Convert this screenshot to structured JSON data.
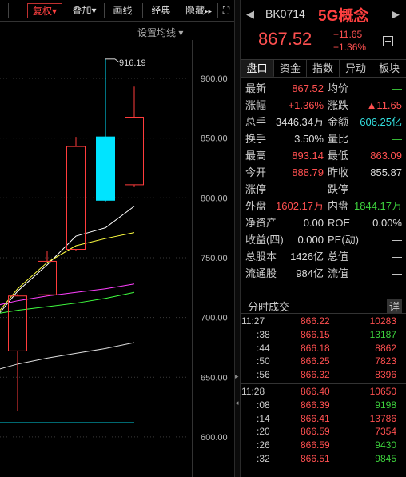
{
  "toolbar": {
    "items": [
      "一",
      "复权",
      "叠加",
      "画线",
      "经典",
      "隐藏"
    ],
    "fuquan_arrow": "▾",
    "diejia_arrow": "▾",
    "more_icon": "▸▸",
    "expand_icon": "⛶"
  },
  "chart": {
    "settings_label": "设置均线",
    "settings_arrow": "▾",
    "high_marker": "916.19",
    "price_axis": [
      "900.00",
      "850.00",
      "800.00",
      "750.00",
      "700.00",
      "650.00",
      "600.00"
    ],
    "colors": {
      "up": "#ff3c3c",
      "down": "#00e4ff",
      "ma1": "#ffffff",
      "ma2": "#ffff40",
      "ma3": "#ff40ff",
      "ma4": "#40ff40",
      "ma5": "#dddddd",
      "ma6": "#00d0e0"
    }
  },
  "chart_data": {
    "type": "candlestick",
    "ylim": [
      590,
      935
    ],
    "candles": [
      {
        "open": 672,
        "close": 718,
        "high": 720,
        "low": 622,
        "direction": "up"
      },
      {
        "open": 719,
        "close": 747,
        "high": 756,
        "low": 718,
        "direction": "up"
      },
      {
        "open": 757,
        "close": 843,
        "high": 851,
        "low": 756,
        "direction": "up"
      },
      {
        "open": 851,
        "close": 798,
        "high": 916.19,
        "low": 797,
        "direction": "down"
      },
      {
        "open": 811,
        "close": 867.52,
        "high": 893.14,
        "low": 809,
        "direction": "up"
      }
    ],
    "ma_lines": [
      {
        "name": "ma1",
        "values": [
          722,
          744,
          768,
          775,
          793
        ]
      },
      {
        "name": "ma2",
        "values": [
          724,
          746,
          760,
          766,
          771
        ]
      },
      {
        "name": "ma3",
        "values": [
          714,
          718,
          721,
          724,
          728
        ]
      },
      {
        "name": "ma4",
        "values": [
          706,
          709,
          712,
          716,
          721
        ]
      },
      {
        "name": "ma5",
        "values": [
          661,
          666,
          670,
          674,
          679
        ]
      },
      {
        "name": "ma6",
        "values": [
          612,
          612,
          612,
          612,
          612
        ]
      }
    ]
  },
  "header": {
    "code": "BK0714",
    "name": "5G概念",
    "price": "867.52",
    "change": "+11.65",
    "change_pct": "+1.36%",
    "prev_icon": "◀",
    "next_icon": "▶"
  },
  "tabs": [
    "盘口",
    "资金",
    "指数",
    "异动",
    "板块"
  ],
  "quote": [
    {
      "l1": "最新",
      "v1": "867.52",
      "c1": "red",
      "l2": "均价",
      "v2": "—",
      "c2": "green"
    },
    {
      "l1": "涨幅",
      "v1": "+1.36%",
      "c1": "red",
      "l2": "涨跌",
      "v2": "▲11.65",
      "c2": "red"
    },
    {
      "l1": "总手",
      "v1": "3446.34万",
      "c1": "white",
      "l2": "金额",
      "v2": "606.25亿",
      "c2": "cyan"
    },
    {
      "l1": "换手",
      "v1": "3.50%",
      "c1": "white",
      "l2": "量比",
      "v2": "—",
      "c2": "green"
    },
    {
      "l1": "最高",
      "v1": "893.14",
      "c1": "red",
      "l2": "最低",
      "v2": "863.09",
      "c2": "red"
    },
    {
      "l1": "今开",
      "v1": "888.79",
      "c1": "red",
      "l2": "昨收",
      "v2": "855.87",
      "c2": "white"
    },
    {
      "l1": "涨停",
      "v1": "—",
      "c1": "red",
      "l2": "跌停",
      "v2": "—",
      "c2": "green"
    },
    {
      "l1": "外盘",
      "v1": "1602.17万",
      "c1": "red",
      "l2": "内盘",
      "v2": "1844.17万",
      "c2": "green"
    },
    {
      "l1": "净资产",
      "v1": "0.00",
      "c1": "white",
      "l2": "ROE",
      "v2": "0.00%",
      "c2": "white"
    },
    {
      "l1": "收益(四)",
      "v1": "0.000",
      "c1": "white",
      "l2": "PE(动)",
      "v2": "—",
      "c2": "white"
    },
    {
      "l1": "总股本",
      "v1": "1426亿",
      "c1": "white",
      "l2": "总值",
      "v2": "—",
      "c2": "white"
    },
    {
      "l1": "流通股",
      "v1": "984亿",
      "c1": "white",
      "l2": "流值",
      "v2": "—",
      "c2": "white"
    }
  ],
  "ticks": {
    "title": "分时成交",
    "detail": "详",
    "rows": [
      {
        "time": "11:27",
        "price": "866.22",
        "vol": "10283",
        "vc": "red"
      },
      {
        "time": ":38",
        "price": "866.15",
        "vol": "13187",
        "vc": "green"
      },
      {
        "time": ":44",
        "price": "866.18",
        "vol": "8862",
        "vc": "red"
      },
      {
        "time": ":50",
        "price": "866.25",
        "vol": "7823",
        "vc": "red"
      },
      {
        "time": ":56",
        "price": "866.32",
        "vol": "8396",
        "vc": "red"
      },
      {
        "time": "11:28",
        "price": "866.40",
        "vol": "10650",
        "vc": "red"
      },
      {
        "time": ":08",
        "price": "866.39",
        "vol": "9198",
        "vc": "green"
      },
      {
        "time": ":14",
        "price": "866.41",
        "vol": "13786",
        "vc": "red"
      },
      {
        "time": ":20",
        "price": "866.59",
        "vol": "7354",
        "vc": "red"
      },
      {
        "time": ":26",
        "price": "866.59",
        "vol": "9430",
        "vc": "green"
      },
      {
        "time": ":32",
        "price": "866.51",
        "vol": "9845",
        "vc": "green"
      }
    ]
  }
}
